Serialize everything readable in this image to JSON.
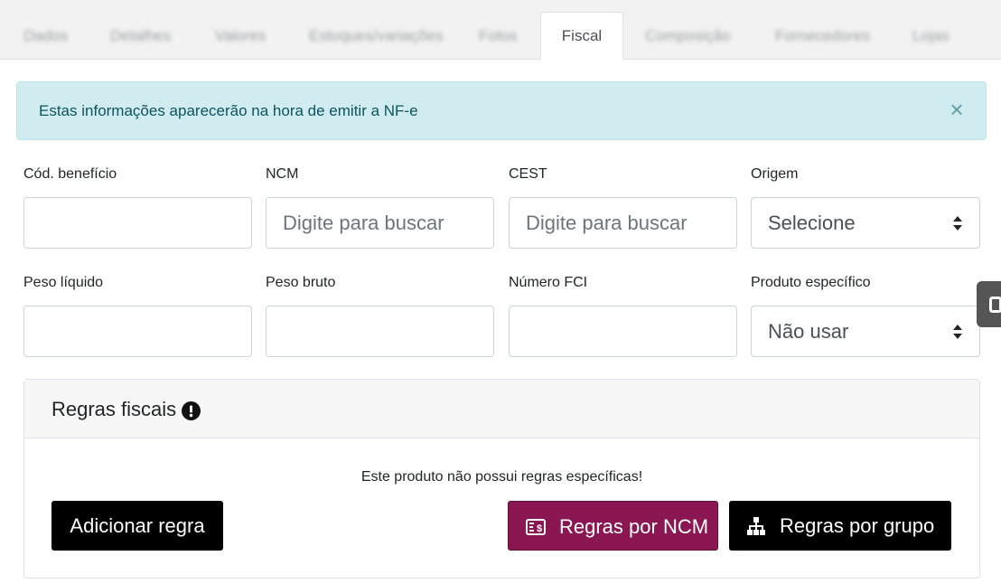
{
  "tabs": [
    {
      "label": "Dados"
    },
    {
      "label": "Detalhes"
    },
    {
      "label": "Valores"
    },
    {
      "label": "Estoques/variações"
    },
    {
      "label": "Fotos"
    },
    {
      "label": "Fiscal"
    },
    {
      "label": "Composição"
    },
    {
      "label": "Fornecedores"
    },
    {
      "label": "Lojas"
    }
  ],
  "active_tab": "Fiscal",
  "alert": {
    "message": "Estas informações aparecerão na hora de emitir a NF-e",
    "close_symbol": "×"
  },
  "fields": {
    "cod_beneficio": {
      "label": "Cód. benefício",
      "value": ""
    },
    "ncm": {
      "label": "NCM",
      "placeholder": "Digite para buscar"
    },
    "cest": {
      "label": "CEST",
      "placeholder": "Digite para buscar"
    },
    "origem": {
      "label": "Origem",
      "selected": "Selecione"
    },
    "peso_liquido": {
      "label": "Peso líquido",
      "value": ""
    },
    "peso_bruto": {
      "label": "Peso bruto",
      "value": ""
    },
    "numero_fci": {
      "label": "Número FCI",
      "value": ""
    },
    "produto_especifico": {
      "label": "Produto específico",
      "selected": "Não usar"
    }
  },
  "regras": {
    "title": "Regras fiscais",
    "empty_message": "Este produto não possui regras específicas!",
    "add_button": "Adicionar regra",
    "ncm_button": "Regras por NCM",
    "group_button": "Regras por grupo"
  },
  "icons": {
    "info": "exclamation-circle-icon",
    "ncm": "money-receipt-icon",
    "group": "sitemap-icon"
  },
  "colors": {
    "alert_bg": "#d1ecf1",
    "alert_text": "#0c5460",
    "ncm_button": "#8b1752",
    "black_button": "#000000"
  }
}
